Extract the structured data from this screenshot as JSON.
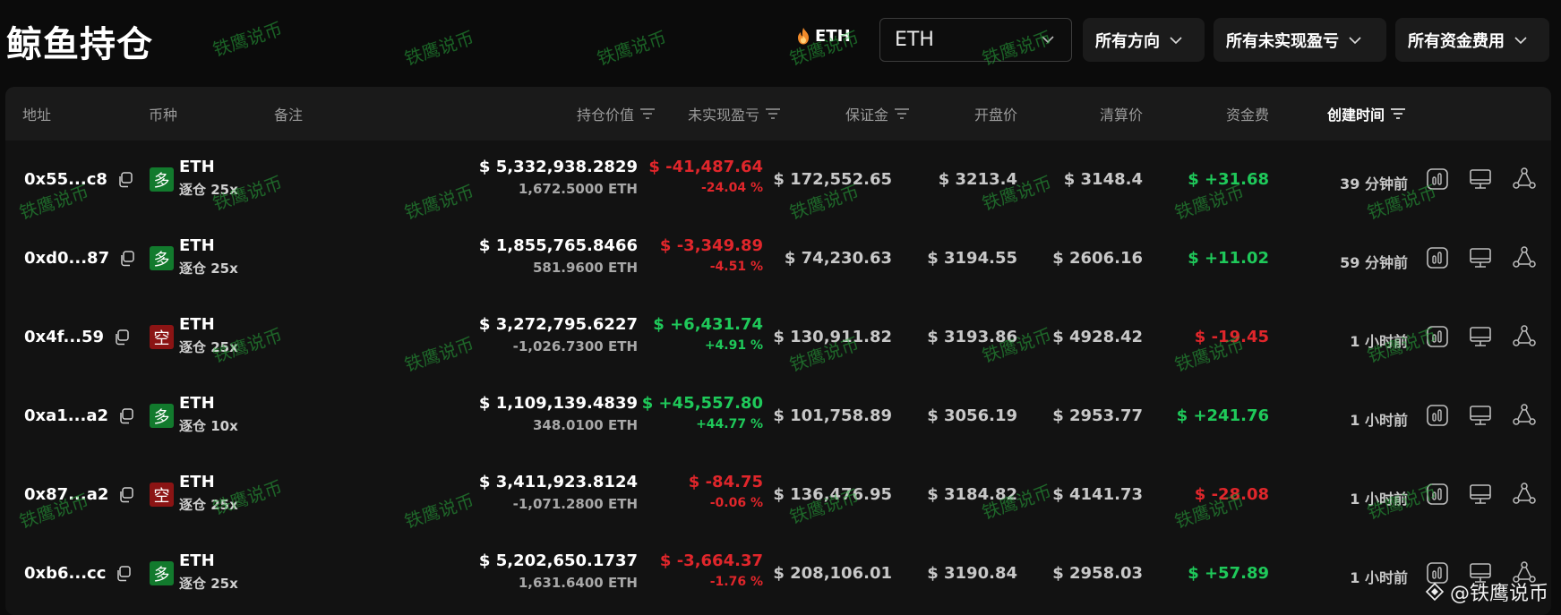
{
  "header": {
    "title": "鲸鱼持仓",
    "coin_chip": "ETH",
    "search_value": "ETH",
    "filters": [
      "所有方向",
      "所有未实现盈亏",
      "所有资金费用"
    ]
  },
  "table": {
    "columns": {
      "address": "地址",
      "coin": "币种",
      "note": "备注",
      "value": "持仓价值",
      "pnl": "未实现盈亏",
      "margin": "保证金",
      "entry": "开盘价",
      "liq": "清算价",
      "funding": "资金费",
      "created": "创建时间"
    },
    "rows": [
      {
        "address": "0x55...c8",
        "side": "多",
        "side_type": "long",
        "coin": "ETH",
        "mode": "逐仓 25x",
        "value": "$ 5,332,938.2829",
        "size": "1,672.5000 ETH",
        "pnl": "$ -41,487.64",
        "pnl_pct": "-24.04 %",
        "pnl_sign": "neg",
        "margin": "$ 172,552.65",
        "entry": "$ 3213.4",
        "liq": "$ 3148.4",
        "funding": "$ +31.68",
        "funding_sign": "pos",
        "time": "39 分钟前"
      },
      {
        "address": "0xd0...87",
        "side": "多",
        "side_type": "long",
        "coin": "ETH",
        "mode": "逐仓 25x",
        "value": "$ 1,855,765.8466",
        "size": "581.9600 ETH",
        "pnl": "$ -3,349.89",
        "pnl_pct": "-4.51 %",
        "pnl_sign": "neg",
        "margin": "$ 74,230.63",
        "entry": "$ 3194.55",
        "liq": "$ 2606.16",
        "funding": "$ +11.02",
        "funding_sign": "pos",
        "time": "59 分钟前"
      },
      {
        "address": "0x4f...59",
        "side": "空",
        "side_type": "short",
        "coin": "ETH",
        "mode": "逐仓 25x",
        "value": "$ 3,272,795.6227",
        "size": "-1,026.7300 ETH",
        "pnl": "$ +6,431.74",
        "pnl_pct": "+4.91 %",
        "pnl_sign": "pos",
        "margin": "$ 130,911.82",
        "entry": "$ 3193.86",
        "liq": "$ 4928.42",
        "funding": "$ -19.45",
        "funding_sign": "neg",
        "time": "1 小时前"
      },
      {
        "address": "0xa1...a2",
        "side": "多",
        "side_type": "long",
        "coin": "ETH",
        "mode": "逐仓 10x",
        "value": "$ 1,109,139.4839",
        "size": "348.0100 ETH",
        "pnl": "$ +45,557.80",
        "pnl_pct": "+44.77 %",
        "pnl_sign": "pos",
        "margin": "$ 101,758.89",
        "entry": "$ 3056.19",
        "liq": "$ 2953.77",
        "funding": "$ +241.76",
        "funding_sign": "pos",
        "time": "1 小时前"
      },
      {
        "address": "0x87...a2",
        "side": "空",
        "side_type": "short",
        "coin": "ETH",
        "mode": "逐仓 25x",
        "value": "$ 3,411,923.8124",
        "size": "-1,071.2800 ETH",
        "pnl": "$ -84.75",
        "pnl_pct": "-0.06 %",
        "pnl_sign": "neg",
        "margin": "$ 136,476.95",
        "entry": "$ 3184.82",
        "liq": "$ 4141.73",
        "funding": "$ -28.08",
        "funding_sign": "neg",
        "time": "1 小时前"
      },
      {
        "address": "0xb6...cc",
        "side": "多",
        "side_type": "long",
        "coin": "ETH",
        "mode": "逐仓 25x",
        "value": "$ 5,202,650.1737",
        "size": "1,631.6400 ETH",
        "pnl": "$ -3,664.37",
        "pnl_pct": "-1.76 %",
        "pnl_sign": "neg",
        "margin": "$ 208,106.01",
        "entry": "$ 3190.84",
        "liq": "$ 2958.03",
        "funding": "$ +57.89",
        "funding_sign": "pos",
        "time": "1 小时前"
      }
    ]
  },
  "watermark": "铁鹰说币",
  "brand": "@铁鹰说币",
  "colors": {
    "long": "#127a2d",
    "short": "#8b1414",
    "positive": "#1fc95a",
    "negative": "#e0262b"
  }
}
